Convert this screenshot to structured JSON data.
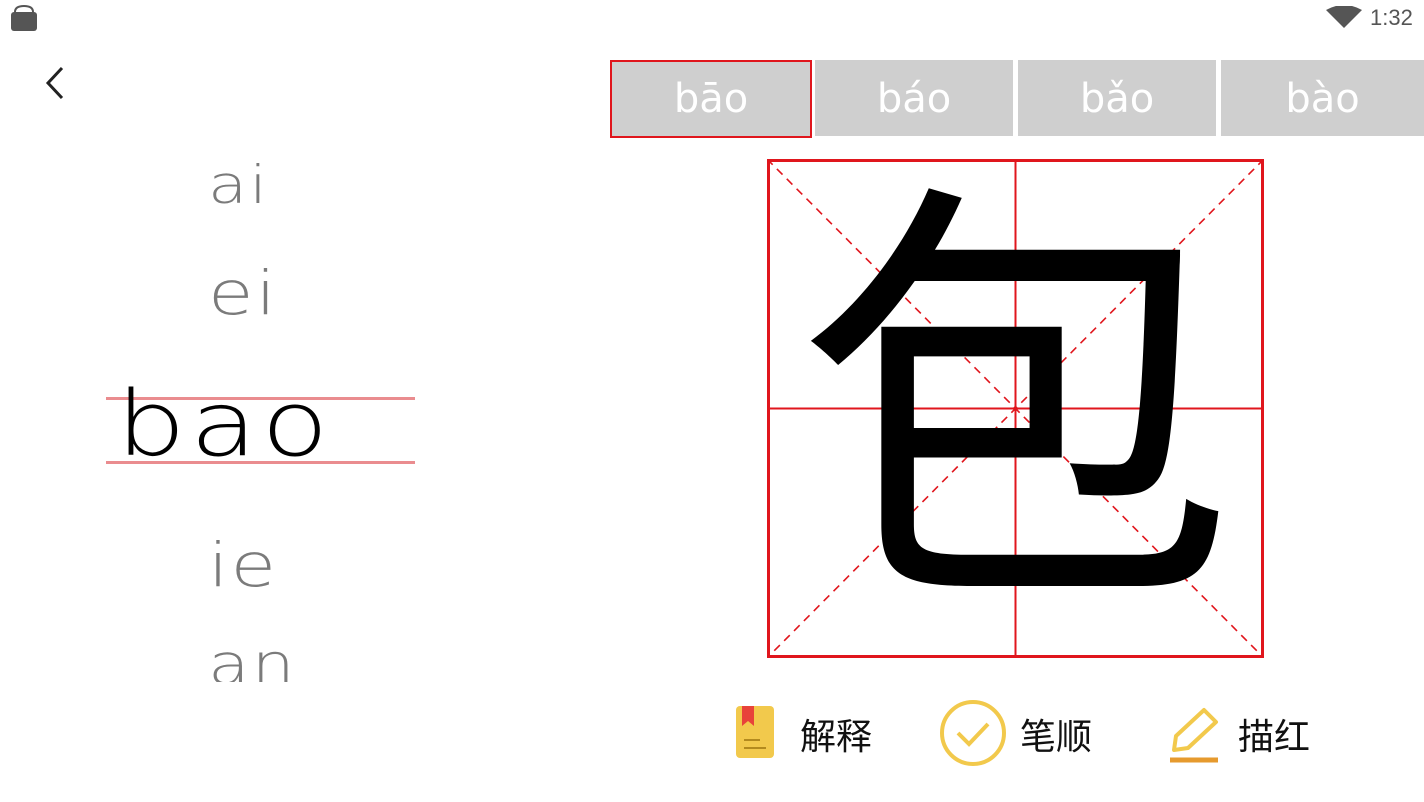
{
  "status_bar": {
    "time": "1:32",
    "icons": [
      "store-icon",
      "wifi-icon"
    ]
  },
  "navigation": {
    "back_icon": "chevron-left-icon"
  },
  "syllables": {
    "above": [
      "ai",
      "ei"
    ],
    "selected": "bao",
    "below": [
      "ie",
      "an"
    ]
  },
  "tones": [
    {
      "label": "bāo",
      "active": true
    },
    {
      "label": "báo",
      "active": false
    },
    {
      "label": "bǎo",
      "active": false
    },
    {
      "label": "bào",
      "active": false
    }
  ],
  "character": "包",
  "actions": [
    {
      "label": "解释",
      "icon": "book-icon"
    },
    {
      "label": "笔顺",
      "icon": "check-circle-icon"
    },
    {
      "label": "描红",
      "icon": "pencil-icon"
    }
  ],
  "colors": {
    "accent_red": "#e0161d",
    "guide_line": "#ea8c8f",
    "tab_gray": "#cfcfcf",
    "icon_yellow": "#f2c94c",
    "syllable_gray": "#7b7b7b"
  }
}
